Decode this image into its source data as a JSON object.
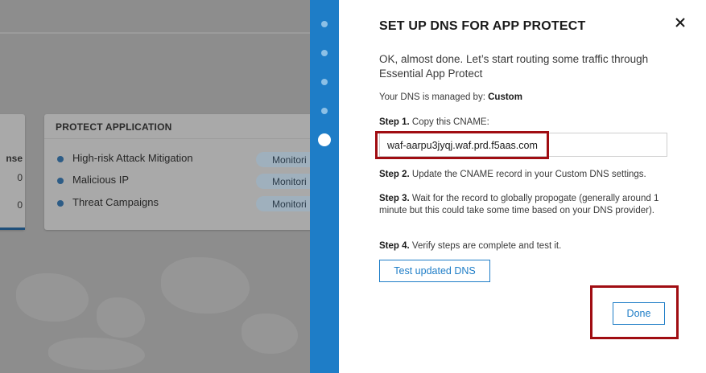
{
  "background": {
    "left_card": {
      "header_fragment": "nse",
      "values": [
        "0",
        "0"
      ]
    },
    "protect_card": {
      "title": "PROTECT APPLICATION",
      "rows": [
        {
          "label": "High-risk Attack Mitigation",
          "status": "Monitori"
        },
        {
          "label": "Malicious IP",
          "status": "Monitori"
        },
        {
          "label": "Threat Campaigns",
          "status": "Monitori"
        }
      ]
    }
  },
  "stepper": {
    "total": 5,
    "active_index": 4
  },
  "panel": {
    "title": "SET UP DNS FOR APP PROTECT",
    "intro": "OK, almost done. Let’s start routing some traffic through Essential App Protect",
    "managed_by_label": "Your DNS is managed by:",
    "managed_by_value": "Custom",
    "step1_label": "Step 1.",
    "step1_text": "Copy this CNAME:",
    "cname_value": "waf-aarpu3jyqj.waf.prd.f5aas.com",
    "step2_label": "Step 2.",
    "step2_text": "Update the CNAME record in your Custom DNS settings.",
    "step3_label": "Step 3.",
    "step3_text": "Wait for the record to globally propogate (generally around 1 minute but this could take some time based on your DNS provider).",
    "step4_label": "Step 4.",
    "step4_text": "Verify steps are complete and test it.",
    "test_button": "Test updated DNS",
    "done_button": "Done",
    "close_icon": "close-icon"
  },
  "colors": {
    "accent": "#1e7dc7",
    "highlight": "#a00d12",
    "overlay": "#8d8d8d"
  }
}
